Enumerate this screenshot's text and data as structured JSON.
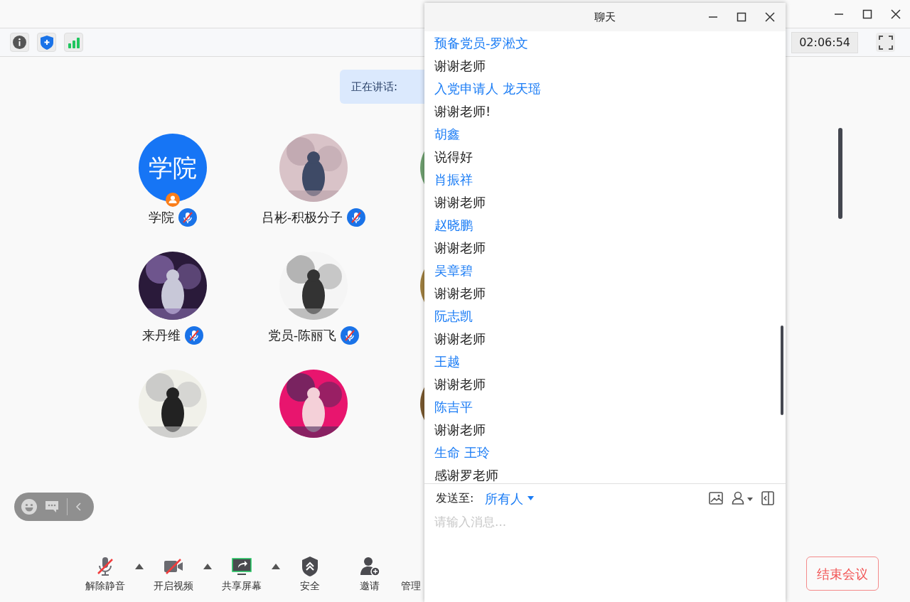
{
  "toolbar": {
    "timer": "02:06:54"
  },
  "speaking": {
    "label": "正在讲话:"
  },
  "participants": [
    {
      "kind": "initials",
      "initials": "学院",
      "name": "学院",
      "muted": true,
      "host": true
    },
    {
      "kind": "picture",
      "name": "吕彬-积极分子",
      "muted": true
    },
    {
      "kind": "picture"
    },
    {
      "kind": "picture",
      "name": "来丹维",
      "muted": true
    },
    {
      "kind": "picture",
      "name": "党员-陈丽飞",
      "muted": true
    },
    {
      "kind": "picture"
    },
    {
      "kind": "picture"
    },
    {
      "kind": "picture"
    },
    {
      "kind": "picture"
    }
  ],
  "controls": [
    {
      "kind": "mic",
      "label": "解除静音",
      "off": true,
      "menu": true
    },
    {
      "kind": "video",
      "label": "开启视频",
      "off": true,
      "menu": true
    },
    {
      "kind": "share",
      "label": "共享屏幕",
      "menu": true
    },
    {
      "kind": "security",
      "label": "安全"
    },
    {
      "kind": "invite",
      "label": "邀请"
    },
    {
      "kind": "manage",
      "label": "管理"
    }
  ],
  "end_button": "结束会议",
  "chat": {
    "title": "聊天",
    "messages": [
      {
        "sender": "预备党员-罗淞文",
        "text": "谢谢老师"
      },
      {
        "sender": "入党申请人 龙天瑶",
        "text": "谢谢老师!"
      },
      {
        "sender": "胡鑫",
        "text": "说得好"
      },
      {
        "sender": "肖振祥",
        "text": "谢谢老师"
      },
      {
        "sender": "赵晓鹏",
        "text": "谢谢老师"
      },
      {
        "sender": "吴章碧",
        "text": "谢谢老师"
      },
      {
        "sender": "阮志凯",
        "text": "谢谢老师"
      },
      {
        "sender": "王越",
        "text": "谢谢老师"
      },
      {
        "sender": "陈吉平",
        "text": "谢谢老师"
      },
      {
        "sender": "生命 王玲",
        "text": "感谢罗老师"
      }
    ],
    "send_to_label": "发送至:",
    "send_to_value": "所有人",
    "placeholder": "请输入消息..."
  }
}
